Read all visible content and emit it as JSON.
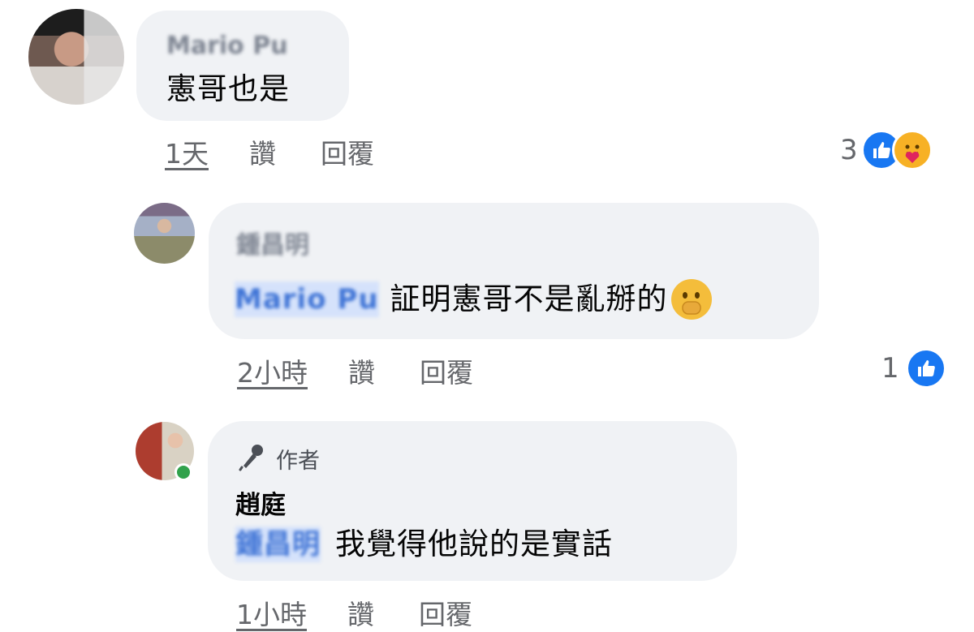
{
  "comments": [
    {
      "author": "Mario Pu",
      "text": "憲哥也是",
      "actions": {
        "time": "1天",
        "like": "讚",
        "reply": "回覆"
      },
      "reaction_count": "3",
      "reactions": [
        "like-icon",
        "care-icon"
      ]
    },
    {
      "author": "鍾昌明",
      "mention": "Mario Pu",
      "text": "証明憲哥不是亂掰的",
      "emoji": "shushing-face",
      "actions": {
        "time": "2小時",
        "like": "讚",
        "reply": "回覆"
      },
      "reaction_count": "1",
      "reactions": [
        "like-icon"
      ]
    },
    {
      "badge": "作者",
      "author": "趙庭",
      "mention": "鍾昌明",
      "text": "我覺得他說的是實話",
      "actions": {
        "time": "1小時",
        "like": "讚",
        "reply": "回覆"
      }
    }
  ],
  "colors": {
    "bubble": "#f0f2f5",
    "secondary_text": "#65676b",
    "like_blue": "#1877f2",
    "online_green": "#31a24c"
  }
}
